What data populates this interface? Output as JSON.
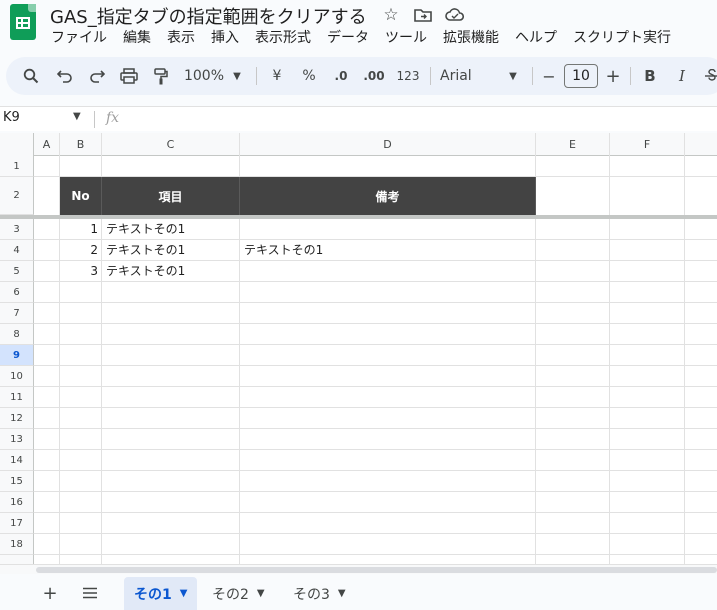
{
  "title": "GAS_指定タブの指定範囲をクリアする",
  "menu": [
    "ファイル",
    "編集",
    "表示",
    "挿入",
    "表示形式",
    "データ",
    "ツール",
    "拡張機能",
    "ヘルプ",
    "スクリプト実行"
  ],
  "toolbar": {
    "zoom": "100%",
    "currency": "¥",
    "percent": "%",
    "decrease_decimal": ".0",
    "increase_decimal": ".00",
    "number_format": "123",
    "font": "Arial",
    "font_size": "10",
    "minus": "−",
    "plus": "+",
    "bold": "B",
    "italic": "I"
  },
  "name_box": "K9",
  "formula_label": "fx",
  "columns": [
    "A",
    "B",
    "C",
    "D",
    "E",
    "F"
  ],
  "rows": [
    "1",
    "2",
    "3",
    "4",
    "5",
    "6",
    "7",
    "8",
    "9",
    "10",
    "11",
    "12",
    "13",
    "14",
    "15",
    "16",
    "17",
    "18"
  ],
  "active_row": "9",
  "table": {
    "headers": [
      "No",
      "項目",
      "備考"
    ],
    "rows": [
      {
        "no": "1",
        "item": "テキストその1",
        "note": ""
      },
      {
        "no": "2",
        "item": "テキストその1",
        "note": "テキストその1"
      },
      {
        "no": "3",
        "item": "テキストその1",
        "note": ""
      }
    ]
  },
  "sheets": [
    "その1",
    "その2",
    "その3"
  ],
  "active_sheet": "その1",
  "colors": {
    "header_bg": "#434343",
    "active_tab": "#0b57d0",
    "app_green": "#0f9d58"
  }
}
